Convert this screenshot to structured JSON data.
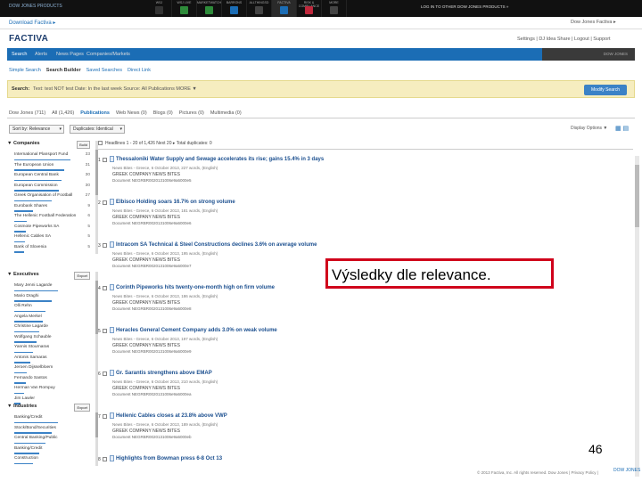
{
  "topbar": {
    "publication": "DOW JONES PRODUCTS",
    "tabs": [
      {
        "label": "WSJ",
        "color": "#333333",
        "active": false
      },
      {
        "label": "WSJ LIVE",
        "color": "#2e8b3a",
        "active": false
      },
      {
        "label": "MARKETWATCH",
        "color": "#2e8b3a",
        "active": false
      },
      {
        "label": "BARRONS",
        "color": "#1b6db5",
        "active": false
      },
      {
        "label": "ALLTHINGSD",
        "color": "#444444",
        "active": false
      },
      {
        "label": "FACTIVA",
        "color": "#1b6db5",
        "active": true
      },
      {
        "label": "RISK & COMPLIANCE",
        "color": "#c0283c",
        "active": false
      },
      {
        "label": "MORE",
        "color": "#444444",
        "active": false
      }
    ],
    "promo": "LOG IN TO OTHER DOW JONES PRODUCTS »"
  },
  "userline": {
    "left": "Download Factiva ▸",
    "right": "Dow Jones Factiva ▸"
  },
  "header": {
    "logo": "FACTIVA",
    "account": "Settings  |  DJ Idea Share  |  Logout  |  Support"
  },
  "nav": {
    "items": [
      "Search",
      "Alerts",
      "News Pages",
      "Companies/Markets"
    ],
    "active": "Search",
    "brand": "DOW JONES"
  },
  "subnav": [
    "Simple Search",
    "Search Builder",
    "Saved Searches",
    "Direct Link"
  ],
  "search": {
    "label": "Search:",
    "query": "Text: test NOT test  Date: In the last week  Source: All Publications  MORE ▼",
    "modify": "Modify Search"
  },
  "source_tabs": [
    "Dow Jones (711)",
    "All (1,426)",
    "Publications",
    "Web News (0)",
    "Blogs (0)",
    "Pictures (0)",
    "Multimedia (0)"
  ],
  "controls": {
    "sort": "Sort by: Relevance",
    "dupes": "Duplicates: Identical",
    "display": "Display Options ▼",
    "view_icons": "▦ ▤"
  },
  "facets": [
    {
      "title": "▼ Companies",
      "button": "Build",
      "items": [
        {
          "label": "International Plansport Fund",
          "n": "33",
          "fill": 0.9
        },
        {
          "label": "The European Union",
          "n": "31",
          "fill": 0.8
        },
        {
          "label": "European Central Bank",
          "n": "30",
          "fill": 0.75
        },
        {
          "label": "European Commission",
          "n": "30",
          "fill": 0.72
        },
        {
          "label": "Greek Organisation of Football",
          "n": "27",
          "fill": 0.6
        },
        {
          "label": "Eurobank Shares",
          "n": "9",
          "fill": 0.3
        },
        {
          "label": "The Hellenic Football Federation",
          "n": "6",
          "fill": 0.2
        },
        {
          "label": "Cosmote Pipeworks SA",
          "n": "5",
          "fill": 0.18
        },
        {
          "label": "Hellenic Cables SA",
          "n": "5",
          "fill": 0.17
        },
        {
          "label": "Bank of Slovenia",
          "n": "5",
          "fill": 0.15
        }
      ]
    },
    {
      "title": "▼ Executives",
      "button": "Export",
      "items": [
        {
          "label": "Mary Jenni Lagarde",
          "n": "",
          "fill": 0.7
        },
        {
          "label": "Mario Draghi",
          "n": "",
          "fill": 0.6
        },
        {
          "label": "Olli Rehn",
          "n": "",
          "fill": 0.5
        },
        {
          "label": "Angela Merkel",
          "n": "",
          "fill": 0.45
        },
        {
          "label": "Christine Lagarde",
          "n": "",
          "fill": 0.4
        },
        {
          "label": "Wolfgang Schauble",
          "n": "",
          "fill": 0.35
        },
        {
          "label": "Yannis Stournaras",
          "n": "",
          "fill": 0.3
        },
        {
          "label": "Antonis Samaras",
          "n": "",
          "fill": 0.25
        },
        {
          "label": "Jeroen Dijsselbloem",
          "n": "",
          "fill": 0.2
        },
        {
          "label": "Fernando Santos",
          "n": "",
          "fill": 0.18
        },
        {
          "label": "Herman Van Rompuy",
          "n": "",
          "fill": 0.15
        },
        {
          "label": "Jim Lawler",
          "n": "",
          "fill": 0.1
        }
      ]
    },
    {
      "title": "▼ Industries",
      "button": "Export",
      "items": [
        {
          "label": "Banking/Credit",
          "n": "",
          "fill": 0.7
        },
        {
          "label": "Stock/Bond/Securities",
          "n": "",
          "fill": 0.6
        },
        {
          "label": "Central Banking/Public",
          "n": "",
          "fill": 0.5
        },
        {
          "label": "Banking/Credit",
          "n": "",
          "fill": 0.4
        },
        {
          "label": "Construction",
          "n": "",
          "fill": 0.3
        }
      ]
    }
  ],
  "results_header": "Headlines 1 - 20 of 1,426  Next 20 ▸  Total duplicates: 0",
  "results": [
    {
      "num": "1",
      "title": "Thessaloniki Water Supply and Sewage accelerates its rise; gains 15.4% in 3 days",
      "meta": "News Bites - Greece, 6 October 2013, 227 words, (English)",
      "source": "GREEK COMPANY NEWS BITES",
      "doc": "Document NEGRBR0020131006e9a6000e5"
    },
    {
      "num": "2",
      "title": "Elbisco Holding soars 16.7% on strong volume",
      "meta": "News Bites - Greece, 6 October 2013, 181 words, (English)",
      "source": "GREEK COMPANY NEWS BITES",
      "doc": "Document NEGRBR0020131006e9a6000e6"
    },
    {
      "num": "3",
      "title": "Intracom SA Technical & Steel Constructions declines 3.6% on average volume",
      "meta": "News Bites - Greece, 6 October 2013, 195 words, (English)",
      "source": "GREEK COMPANY NEWS BITES",
      "doc": "Document NEGRBR0020131006e9a6000e7"
    },
    {
      "num": "4",
      "title": "Corinth Pipeworks hits twenty-one-month high on firm volume",
      "meta": "News Bites - Greece, 6 October 2013, 186 words, (English)",
      "source": "GREEK COMPANY NEWS BITES",
      "doc": "Document NEGRBR0020131006e9a6000e8"
    },
    {
      "num": "5",
      "title": "Heracles General Cement Company adds 3.0% on weak volume",
      "meta": "News Bites - Greece, 6 October 2013, 197 words, (English)",
      "source": "GREEK COMPANY NEWS BITES",
      "doc": "Document NEGRBR0020131006e9a6000e9"
    },
    {
      "num": "6",
      "title": "Gr. Sarantis strengthens above EMAP",
      "meta": "News Bites - Greece, 6 October 2013, 210 words, (English)",
      "source": "GREEK COMPANY NEWS BITES",
      "doc": "Document NEGRBR0020131006e9a6000ea"
    },
    {
      "num": "7",
      "title": "Hellenic Cables closes at 23.8% above VWP",
      "meta": "News Bites - Greece, 6 October 2013, 189 words, (English)",
      "source": "GREEK COMPANY NEWS BITES",
      "doc": "Document NEGRBR0020131006e9a6000eb"
    },
    {
      "num": "8",
      "title": "Highlights from Bowman press 6-8 Oct 13",
      "meta": "",
      "source": "",
      "doc": ""
    }
  ],
  "callout": "Výsledky dle relevance.",
  "slide_number": "46",
  "footer": "© 2013 Factiva, Inc. All rights reserved.  Dow Jones  |  Privacy Policy  |",
  "footer_brand": "DOW JONES"
}
